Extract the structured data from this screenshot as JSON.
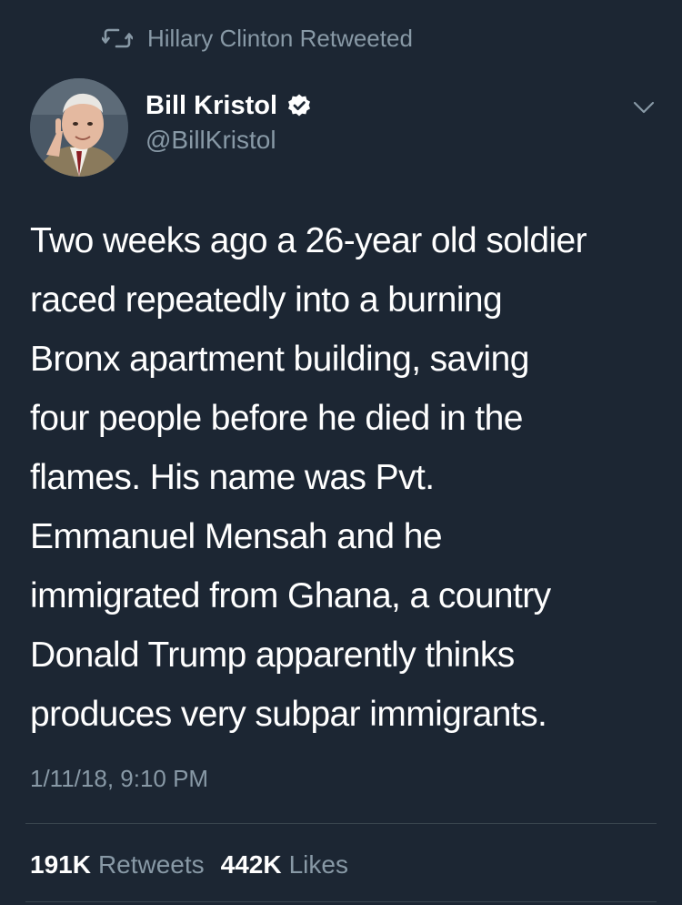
{
  "retweet_context": {
    "icon": "retweet-icon",
    "text": "Hillary Clinton Retweeted"
  },
  "author": {
    "display_name": "Bill Kristol",
    "verified": true,
    "verified_icon": "verified-badge-icon",
    "handle": "@BillKristol"
  },
  "tweet": {
    "lines": [
      "Two weeks ago a 26-year old soldier",
      "raced repeatedly into a burning",
      "Bronx apartment building, saving",
      "four people before he died in the",
      "flames. His name was Pvt.",
      "Emmanuel Mensah and he",
      "immigrated from Ghana, a country",
      "Donald Trump apparently thinks",
      "produces very subpar immigrants."
    ],
    "timestamp": "1/11/18, 9:10 PM"
  },
  "stats": {
    "retweets_count": "191K",
    "retweets_label": "Retweets",
    "likes_count": "442K",
    "likes_label": "Likes"
  },
  "colors": {
    "background": "#1c2633",
    "primary_text": "#ffffff",
    "secondary_text": "#8899a6",
    "divider": "#38444d"
  }
}
